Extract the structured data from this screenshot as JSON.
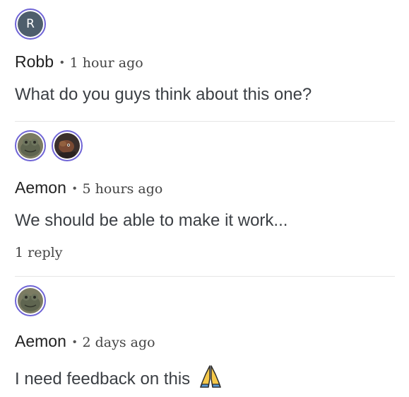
{
  "comments": [
    {
      "avatars": [
        {
          "type": "initial",
          "initial": "R"
        }
      ],
      "author": "Robb",
      "separator": "•",
      "time": "1 hour ago",
      "text": "What do you guys think about this one?"
    },
    {
      "avatars": [
        {
          "type": "frog"
        },
        {
          "type": "creature"
        }
      ],
      "author": "Aemon",
      "separator": "•",
      "time": "5 hours ago",
      "text": "We should be able to make it work...",
      "reply_label": "1 reply"
    },
    {
      "avatars": [
        {
          "type": "frog"
        }
      ],
      "author": "Aemon",
      "separator": "•",
      "time": "2 days ago",
      "text": "I need feedback on this",
      "emoji_icon": "folded-hands-icon"
    }
  ],
  "colors": {
    "avatar_ring": "#6f64d6",
    "initial_avatar_bg": "#4e5e6c",
    "divider": "#e6e6e6"
  }
}
